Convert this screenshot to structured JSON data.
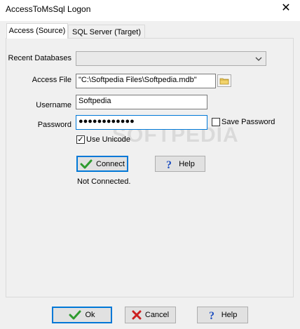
{
  "window": {
    "title": "AccessToMsSql Logon",
    "close_glyph": "✕"
  },
  "tabs": [
    {
      "label": "Access (Source)",
      "active": true
    },
    {
      "label": "SQL Server (Target)",
      "active": false
    }
  ],
  "form": {
    "recent_label": "Recent Databases",
    "recent_value": "",
    "access_file_label": "Access File",
    "access_file_value": "\"C:\\Softpedia Files\\Softpedia.mdb\"",
    "username_label": "Username",
    "username_value": "Softpedia",
    "password_label": "Password",
    "password_value": "●●●●●●●●●●●●",
    "save_password_label": "Save Password",
    "save_password_checked": false,
    "use_unicode_label": "Use Unicode",
    "use_unicode_checked": true,
    "connect_label": "Connect",
    "help_label": "Help",
    "status": "Not Connected."
  },
  "footer": {
    "ok_label": "Ok",
    "cancel_label": "Cancel",
    "help_label": "Help"
  },
  "watermark": "SOFTPEDIA",
  "colors": {
    "accent": "#0078d7",
    "check_green": "#2e9b2e",
    "cancel_red": "#cc2020",
    "help_blue": "#2050c0"
  }
}
